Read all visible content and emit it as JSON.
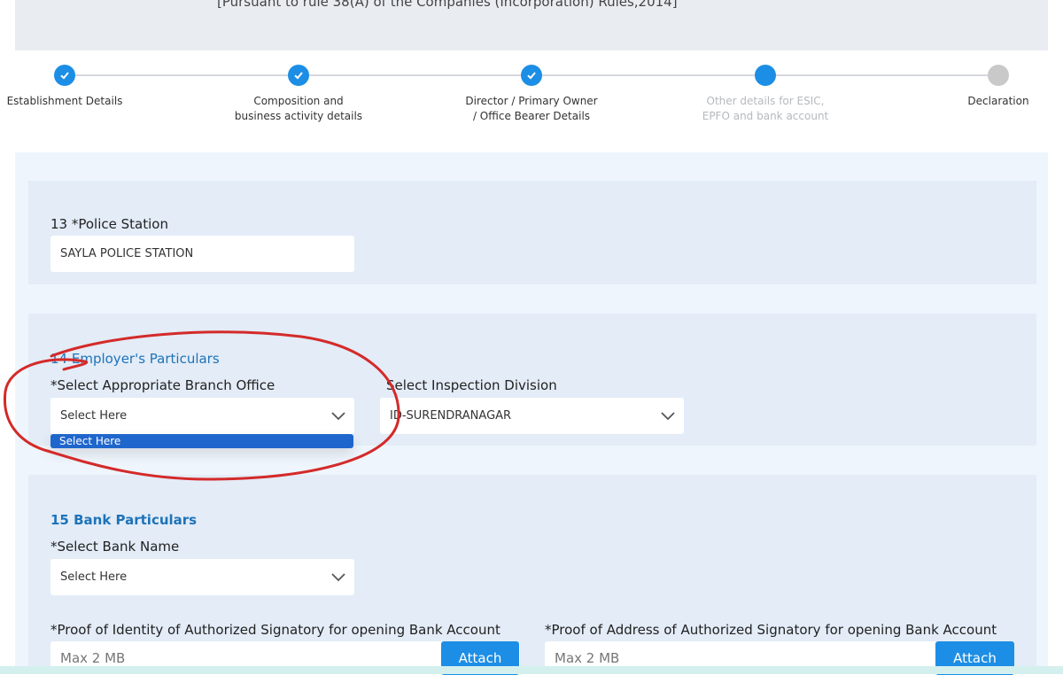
{
  "header": {
    "rule_text": "[Pursuant to rule 38(A) of the Companies (Incorporation) Rules,2014]"
  },
  "stepper": {
    "steps": [
      {
        "label": "Establishment Details",
        "state": "done"
      },
      {
        "label": "Composition and business activity details",
        "state": "done"
      },
      {
        "label": "Director / Primary Owner / Office Bearer Details",
        "state": "done"
      },
      {
        "label": "Other details for ESIC, EPFO and bank account",
        "state": "active"
      },
      {
        "label": "Declaration",
        "state": "todo"
      }
    ]
  },
  "police": {
    "label": "13 *Police Station",
    "value": "SAYLA POLICE STATION"
  },
  "employer": {
    "title": "14 Employer's Particulars",
    "branch_label": "*Select Appropriate Branch Office",
    "branch_value": "Select Here",
    "branch_option": "Select Here",
    "division_label": "Select Inspection Division",
    "division_value": "ID-SURENDRANAGAR"
  },
  "bank": {
    "title": "15 Bank Particulars",
    "bank_label": "*Select Bank Name",
    "bank_value": "Select Here",
    "identity_label": "*Proof of Identity of Authorized Signatory for opening Bank Account",
    "identity_placeholder": "Max 2 MB",
    "identity_button": "Attach",
    "address_label": "*Proof of Address of Authorized Signatory for opening Bank Account",
    "address_placeholder": "Max 2 MB",
    "address_button": "Attach"
  },
  "colors": {
    "accent": "#1d8ee5",
    "section_title": "#1e73b8",
    "annotation": "#d42a2a"
  }
}
